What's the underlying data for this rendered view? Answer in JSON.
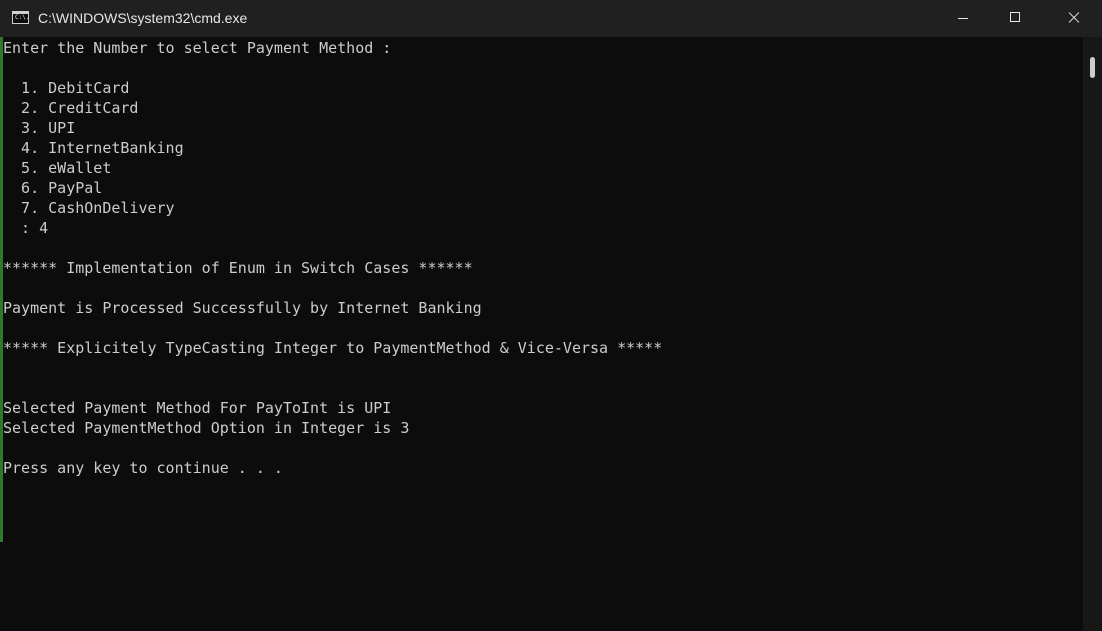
{
  "window": {
    "title": "C:\\WINDOWS\\system32\\cmd.exe",
    "icon_label": "C:\\."
  },
  "console": {
    "lines": [
      "Enter the Number to select Payment Method :",
      "",
      "  1. DebitCard",
      "  2. CreditCard",
      "  3. UPI",
      "  4. InternetBanking",
      "  5. eWallet",
      "  6. PayPal",
      "  7. CashOnDelivery",
      "  : 4",
      "",
      "****** Implementation of Enum in Switch Cases ******",
      "",
      "Payment is Processed Successfully by Internet Banking",
      "",
      "***** Explicitely TypeCasting Integer to PaymentMethod & Vice-Versa *****",
      "",
      "",
      "Selected Payment Method For PayToInt is UPI",
      "Selected PaymentMethod Option in Integer is 3",
      "",
      "Press any key to continue . . ."
    ]
  },
  "colors": {
    "background": "#0c0c0c",
    "titlebar": "#202020",
    "text": "#cccccc",
    "accent": "#2f7a2a"
  },
  "icons": {
    "app": "cmd-icon",
    "minimize": "minimize-icon",
    "maximize": "maximize-icon",
    "close": "close-icon"
  }
}
